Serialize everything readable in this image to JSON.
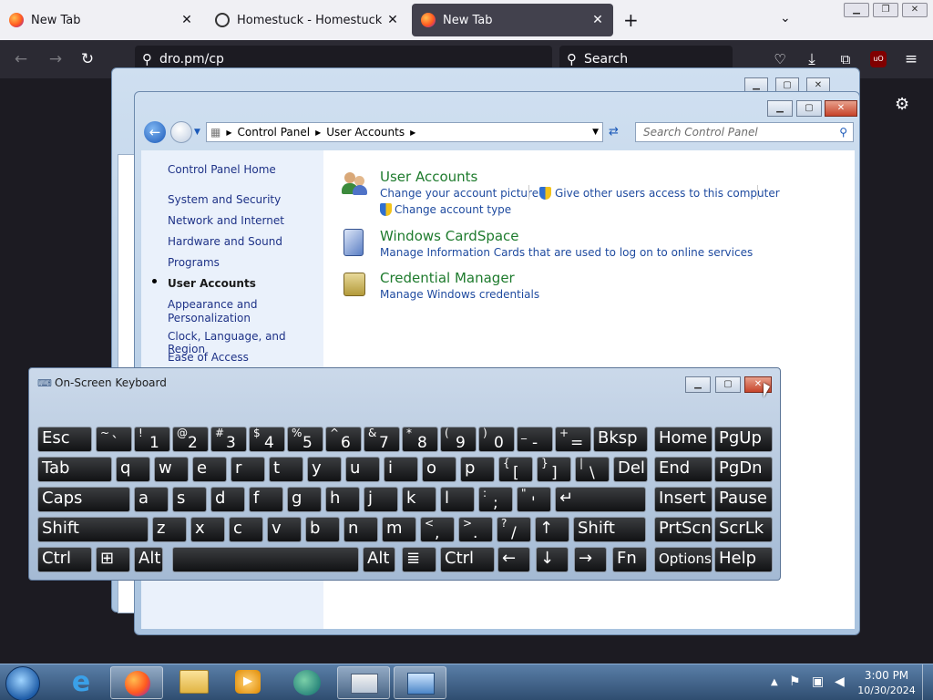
{
  "browser": {
    "tabs": [
      {
        "label": "New Tab",
        "icon": "firefox-icon"
      },
      {
        "label": "Homestuck - Homestuck",
        "icon": "homestuck-icon"
      },
      {
        "label": "New Tab",
        "icon": "firefox-icon",
        "active": true
      }
    ],
    "url": "dro.pm/cp",
    "search_placeholder": "Search",
    "new_tab_symbol": "+",
    "close_symbol": "✕"
  },
  "control_panel": {
    "breadcrumb": [
      "Control Panel",
      "User Accounts"
    ],
    "search_placeholder": "Search Control Panel",
    "sidebar": {
      "home": "Control Panel Home",
      "items": [
        "System and Security",
        "Network and Internet",
        "Hardware and Sound",
        "Programs",
        "User Accounts",
        "Appearance and Personalization",
        "Clock, Language, and Region",
        "Ease of Access"
      ],
      "selected": "User Accounts"
    },
    "categories": [
      {
        "title": "User Accounts",
        "links": [
          "Change your account picture",
          "Give other users access to this computer",
          "Change account type"
        ]
      },
      {
        "title": "Windows CardSpace",
        "links": [
          "Manage Information Cards that are used to log on to online services"
        ]
      },
      {
        "title": "Credential Manager",
        "links": [
          "Manage Windows credentials"
        ]
      }
    ]
  },
  "osk": {
    "title": "On-Screen Keyboard",
    "rows": [
      [
        [
          "Esc",
          ""
        ],
        [
          "~",
          "`"
        ],
        [
          "!",
          "1"
        ],
        [
          "@",
          "2"
        ],
        [
          "#",
          "3"
        ],
        [
          "$",
          "4"
        ],
        [
          "%",
          "5"
        ],
        [
          "^",
          "6"
        ],
        [
          "&",
          "7"
        ],
        [
          "*",
          "8"
        ],
        [
          "(",
          "9"
        ],
        [
          ")",
          "0"
        ],
        [
          "_",
          "-"
        ],
        [
          "+",
          "="
        ],
        [
          "Bksp",
          ""
        ],
        [
          "Home",
          ""
        ],
        [
          "PgUp",
          ""
        ]
      ],
      [
        [
          "Tab",
          ""
        ],
        [
          "q",
          ""
        ],
        [
          "w",
          ""
        ],
        [
          "e",
          ""
        ],
        [
          "r",
          ""
        ],
        [
          "t",
          ""
        ],
        [
          "y",
          ""
        ],
        [
          "u",
          ""
        ],
        [
          "i",
          ""
        ],
        [
          "o",
          ""
        ],
        [
          "p",
          ""
        ],
        [
          "{",
          "["
        ],
        [
          "}",
          "]"
        ],
        [
          "|",
          "\\"
        ],
        [
          "Del",
          ""
        ],
        [
          "End",
          ""
        ],
        [
          "PgDn",
          ""
        ]
      ],
      [
        [
          "Caps",
          ""
        ],
        [
          "a",
          ""
        ],
        [
          "s",
          ""
        ],
        [
          "d",
          ""
        ],
        [
          "f",
          ""
        ],
        [
          "g",
          ""
        ],
        [
          "h",
          ""
        ],
        [
          "j",
          ""
        ],
        [
          "k",
          ""
        ],
        [
          "l",
          ""
        ],
        [
          ":",
          ";"
        ],
        [
          "\"",
          "'"
        ],
        [
          "↵",
          ""
        ],
        [
          "Insert",
          ""
        ],
        [
          "Pause",
          ""
        ]
      ],
      [
        [
          "Shift",
          ""
        ],
        [
          "z",
          ""
        ],
        [
          "x",
          ""
        ],
        [
          "c",
          ""
        ],
        [
          "v",
          ""
        ],
        [
          "b",
          ""
        ],
        [
          "n",
          ""
        ],
        [
          "m",
          ""
        ],
        [
          "<",
          ","
        ],
        [
          ">",
          "."
        ],
        [
          "?",
          "/"
        ],
        [
          "↑",
          ""
        ],
        [
          "Shift",
          ""
        ],
        [
          "PrtScn",
          ""
        ],
        [
          "ScrLk",
          ""
        ]
      ],
      [
        [
          "Ctrl",
          ""
        ],
        [
          "⊞",
          ""
        ],
        [
          "Alt",
          ""
        ],
        [
          "",
          ""
        ],
        [
          "Alt",
          ""
        ],
        [
          "≣",
          ""
        ],
        [
          "Ctrl",
          ""
        ],
        [
          "←",
          ""
        ],
        [
          "↓",
          ""
        ],
        [
          "→",
          ""
        ],
        [
          "Fn",
          ""
        ],
        [
          "Options",
          ""
        ],
        [
          "Help",
          ""
        ]
      ]
    ]
  },
  "taskbar": {
    "items": [
      "start-orb",
      "internet-explorer",
      "firefox",
      "file-explorer",
      "media-player",
      "tor-browser",
      "on-screen-keyboard",
      "control-panel"
    ],
    "time": "3:00 PM",
    "date": "10/30/2024"
  },
  "colors": {
    "browser_dark": "#1c1b22",
    "link_blue": "#1e4a9f",
    "category_green": "#1e7b2d"
  }
}
